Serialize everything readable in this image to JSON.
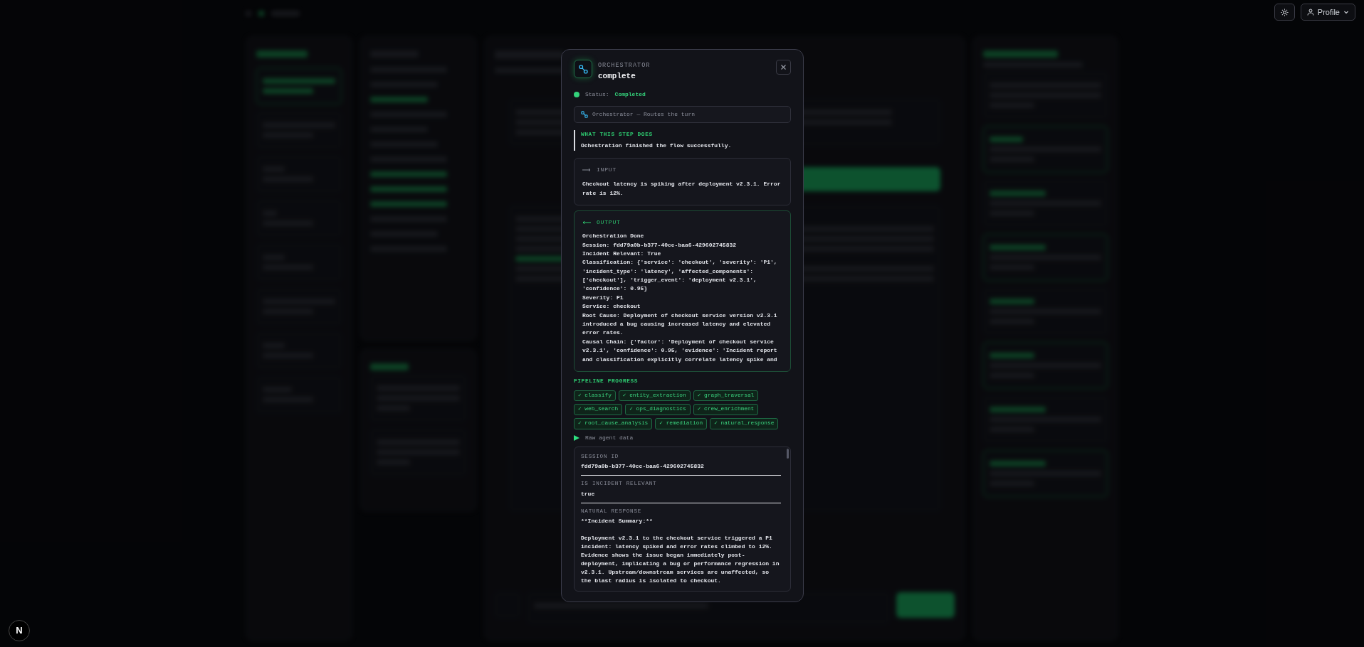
{
  "top_bar": {
    "profile_label": "Profile"
  },
  "dev_badge": "N",
  "modal": {
    "kicker": "ORCHESTRATOR",
    "title": "complete",
    "status": {
      "label": "Status:",
      "value": "Completed"
    },
    "agent_chip": "Orchestrator — Routes the turn",
    "step": {
      "heading": "WHAT THIS STEP DOES",
      "text": "Ochestration finished the flow successfully."
    },
    "input": {
      "label": "INPUT",
      "text": "Checkout latency is spiking after deployment v2.3.1. Error rate is 12%."
    },
    "output": {
      "label": "OUTPUT",
      "lines": [
        "Orchestration Done",
        "Session: fdd79a0b-b377-40cc-baa6-429602745832",
        "Incident Relevant: True",
        "Classification: {'service': 'checkout', 'severity': 'P1', 'incident_type': 'latency', 'affected_components': ['checkout'], 'trigger_event': 'deployment v2.3.1', 'confidence': 0.95}",
        "Severity: P1",
        "Service: checkout",
        "Root Cause: Deployment of checkout service version v2.3.1 introduced a bug causing increased latency and elevated error rates.",
        "Causal Chain: {'factor': 'Deployment of checkout service v2.3.1', 'confidence': 0.95, 'evidence': 'Incident report and classification explicitly correlate latency spike and"
      ]
    },
    "pipeline": {
      "heading": "PIPELINE PROGRESS",
      "steps": [
        "✓ classify",
        "✓ entity_extraction",
        "✓ graph_traversal",
        "✓ web_search",
        "✓ ops_diagnostics",
        "✓ crew_enrichment",
        "✓ root_cause_analysis",
        "✓ remediation",
        "✓ natural_response"
      ]
    },
    "raw": {
      "toggle": "Raw agent data",
      "expanded": true,
      "fields": [
        {
          "label": "SESSION ID",
          "value": "fdd79a0b-b377-40cc-baa6-429602745832"
        },
        {
          "label": "IS INCIDENT RELEVANT",
          "value": "true"
        },
        {
          "label": "NATURAL RESPONSE",
          "value": "**Incident Summary:**\n\nDeployment v2.3.1 to the checkout service triggered a P1 incident: latency spiked and error rates climbed to 12%. Evidence shows the issue began immediately post-deployment, implicating a bug or performance regression in v2.3.1. Upstream/downstream services are unaffected, so the blast radius is isolated to checkout."
        }
      ]
    }
  }
}
